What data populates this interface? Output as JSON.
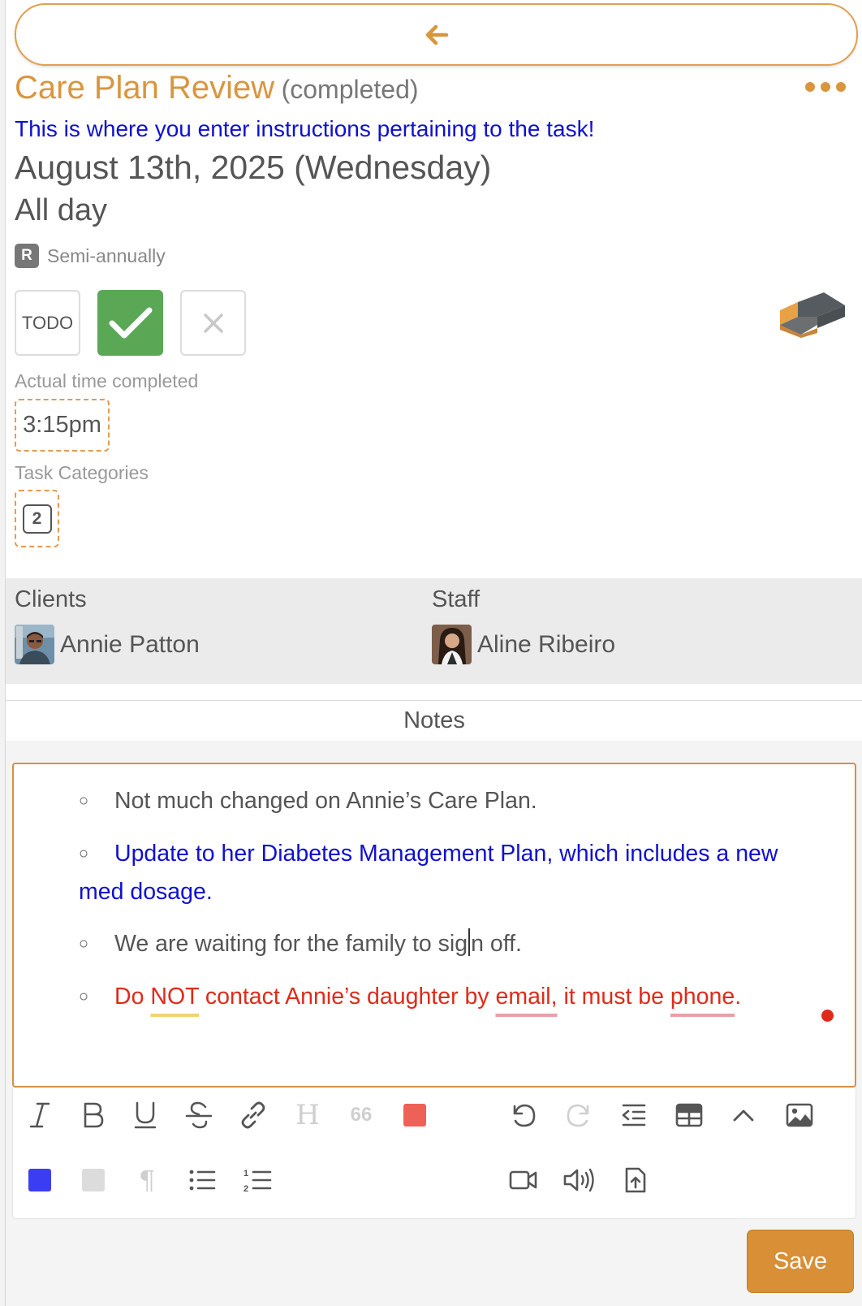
{
  "task": {
    "title": "Care Plan Review",
    "status": "(completed)",
    "instructions": "This is where you enter instructions pertaining to the task!",
    "date": "August 13th, 2025 (Wednesday)",
    "time": "All day",
    "recurrence_badge": "R",
    "recurrence": "Semi-annually",
    "status_buttons": {
      "todo_label": "TODO",
      "done_icon": "check-icon",
      "cancel_icon": "close-icon"
    },
    "actual_time_label": "Actual time completed",
    "actual_time": "3:15pm",
    "categories_label": "Task Categories",
    "categories_count": "2"
  },
  "people": {
    "clients_label": "Clients",
    "client_name": "Annie Patton",
    "staff_label": "Staff",
    "staff_name": "Aline Ribeiro"
  },
  "notes": {
    "heading": "Notes",
    "items": [
      {
        "text": "Not much changed on Annie’s Care Plan.",
        "color": "#555555"
      },
      {
        "text": "Update to her Diabetes Management Plan, which includes a new med dosage.",
        "color": "#1010d0"
      },
      {
        "text_before_caret": "We are waiting for the family to sig",
        "text_after_caret": "n off.",
        "color": "#555555"
      },
      {
        "parts": [
          "Do ",
          "NOT",
          " contact Annie’s daughter by ",
          "email,",
          " it must be ",
          "phone",
          "."
        ],
        "color": "#e02a1a"
      }
    ]
  },
  "toolbar": {
    "icons": [
      "italic-icon",
      "bold-icon",
      "underline-icon",
      "strikethrough-icon",
      "link-icon",
      "heading-icon",
      "quote-icon",
      "text-color-icon",
      "undo-icon",
      "redo-icon",
      "outdent-icon",
      "table-icon",
      "collapse-icon",
      "image-icon",
      "highlight-blue-icon",
      "highlight-gray-icon",
      "paragraph-icon",
      "bullet-list-icon",
      "numbered-list-icon",
      "video-icon",
      "audio-icon",
      "file-upload-icon"
    ],
    "heading_glyph": "H",
    "quote_glyph": "66",
    "paragraph_glyph": "¶",
    "text_color": "#ee6157",
    "highlight_blue": "#3b3ef0",
    "highlight_gray": "#dcdcdc"
  },
  "actions": {
    "save_label": "Save"
  },
  "colors": {
    "accent": "#d9963f",
    "success": "#5aa756",
    "link_blue": "#1010d0",
    "danger": "#e02a1a"
  }
}
